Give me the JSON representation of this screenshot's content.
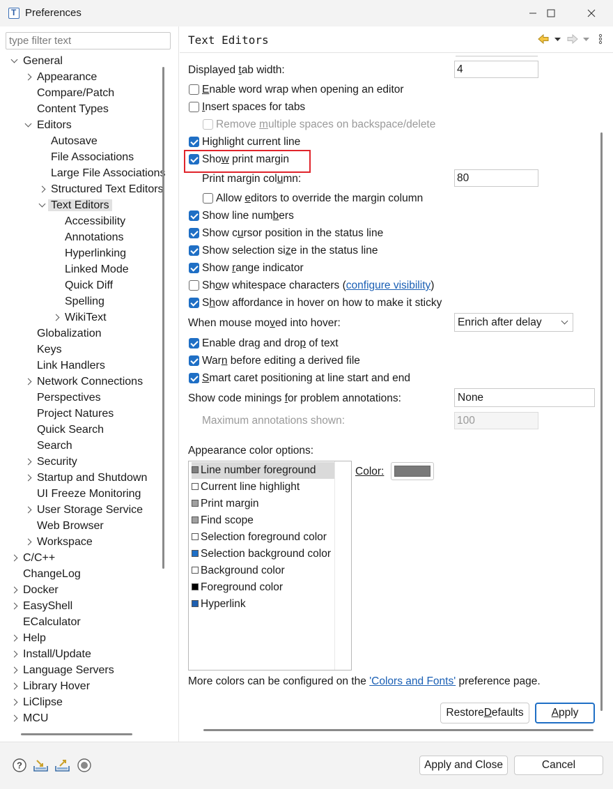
{
  "window": {
    "title": "Preferences"
  },
  "filter": {
    "placeholder": "type filter text"
  },
  "tree": [
    {
      "label": "General",
      "level": 0,
      "state": "expanded"
    },
    {
      "label": "Appearance",
      "level": 1,
      "state": "collapsed"
    },
    {
      "label": "Compare/Patch",
      "level": 1,
      "state": "leaf"
    },
    {
      "label": "Content Types",
      "level": 1,
      "state": "leaf"
    },
    {
      "label": "Editors",
      "level": 1,
      "state": "expanded"
    },
    {
      "label": "Autosave",
      "level": 2,
      "state": "leaf"
    },
    {
      "label": "File Associations",
      "level": 2,
      "state": "leaf"
    },
    {
      "label": "Large File Associations",
      "level": 2,
      "state": "leaf"
    },
    {
      "label": "Structured Text Editors",
      "level": 2,
      "state": "collapsed"
    },
    {
      "label": "Text Editors",
      "level": 2,
      "state": "expanded",
      "selected": true
    },
    {
      "label": "Accessibility",
      "level": 3,
      "state": "leaf"
    },
    {
      "label": "Annotations",
      "level": 3,
      "state": "leaf"
    },
    {
      "label": "Hyperlinking",
      "level": 3,
      "state": "leaf"
    },
    {
      "label": "Linked Mode",
      "level": 3,
      "state": "leaf"
    },
    {
      "label": "Quick Diff",
      "level": 3,
      "state": "leaf"
    },
    {
      "label": "Spelling",
      "level": 3,
      "state": "leaf"
    },
    {
      "label": "WikiText",
      "level": 3,
      "state": "collapsed"
    },
    {
      "label": "Globalization",
      "level": 1,
      "state": "leaf"
    },
    {
      "label": "Keys",
      "level": 1,
      "state": "leaf"
    },
    {
      "label": "Link Handlers",
      "level": 1,
      "state": "leaf"
    },
    {
      "label": "Network Connections",
      "level": 1,
      "state": "collapsed"
    },
    {
      "label": "Perspectives",
      "level": 1,
      "state": "leaf"
    },
    {
      "label": "Project Natures",
      "level": 1,
      "state": "leaf"
    },
    {
      "label": "Quick Search",
      "level": 1,
      "state": "leaf"
    },
    {
      "label": "Search",
      "level": 1,
      "state": "leaf"
    },
    {
      "label": "Security",
      "level": 1,
      "state": "collapsed"
    },
    {
      "label": "Startup and Shutdown",
      "level": 1,
      "state": "collapsed"
    },
    {
      "label": "UI Freeze Monitoring",
      "level": 1,
      "state": "leaf"
    },
    {
      "label": "User Storage Service",
      "level": 1,
      "state": "collapsed"
    },
    {
      "label": "Web Browser",
      "level": 1,
      "state": "leaf"
    },
    {
      "label": "Workspace",
      "level": 1,
      "state": "collapsed"
    },
    {
      "label": "C/C++",
      "level": 0,
      "state": "collapsed"
    },
    {
      "label": "ChangeLog",
      "level": 0,
      "state": "leaf"
    },
    {
      "label": "Docker",
      "level": 0,
      "state": "collapsed"
    },
    {
      "label": "EasyShell",
      "level": 0,
      "state": "collapsed"
    },
    {
      "label": "ECalculator",
      "level": 0,
      "state": "leaf"
    },
    {
      "label": "Help",
      "level": 0,
      "state": "collapsed"
    },
    {
      "label": "Install/Update",
      "level": 0,
      "state": "collapsed"
    },
    {
      "label": "Language Servers",
      "level": 0,
      "state": "collapsed"
    },
    {
      "label": "Library Hover",
      "level": 0,
      "state": "collapsed"
    },
    {
      "label": "LiClipse",
      "level": 0,
      "state": "collapsed"
    },
    {
      "label": "MCU",
      "level": 0,
      "state": "collapsed"
    }
  ],
  "page": {
    "title": "Text Editors",
    "tab_width": {
      "pre": "Displayed ",
      "u": "t",
      "post": "ab width:",
      "value": "4"
    },
    "word_wrap": {
      "pre": "",
      "u": "E",
      "post": "nable word wrap when opening an editor",
      "checked": false
    },
    "insert_spaces": {
      "pre": "",
      "u": "I",
      "post": "nsert spaces for tabs",
      "checked": false
    },
    "remove_spaces": {
      "pre": "Remove ",
      "u": "m",
      "post": "ultiple spaces on backspace/delete",
      "checked": false,
      "disabled": true
    },
    "highlight_line": {
      "pre": "Hi",
      "u": "g",
      "post": "hlight current line",
      "checked": true
    },
    "print_margin": {
      "pre": "Sho",
      "u": "w",
      "post": " print margin",
      "checked": true
    },
    "margin_column": {
      "pre": "Print margin col",
      "u": "u",
      "post": "mn:",
      "value": "80"
    },
    "allow_override": {
      "pre": "Allow ",
      "u": "e",
      "post": "ditors to override the margin column",
      "checked": false
    },
    "line_numbers": {
      "pre": "Show line num",
      "u": "b",
      "post": "ers",
      "checked": true
    },
    "cursor_position": {
      "pre": "Show c",
      "u": "u",
      "post": "rsor position in the status line",
      "checked": true
    },
    "selection_size": {
      "pre": "Show selection si",
      "u": "z",
      "post": "e in the status line",
      "checked": true
    },
    "range_indicator": {
      "pre": "Show ",
      "u": "r",
      "post": "ange indicator",
      "checked": true
    },
    "whitespace": {
      "pre": "Sh",
      "u": "o",
      "post": "w whitespace characters (",
      "link": "configure visibility",
      "tail": ")",
      "checked": false
    },
    "affordance": {
      "pre": "S",
      "u": "h",
      "post": "ow affordance in hover on how to make it sticky",
      "checked": true
    },
    "hover": {
      "pre": "When mouse mo",
      "u": "v",
      "post": "ed into hover:",
      "value": "Enrich after delay"
    },
    "drag_drop": {
      "pre": "Enable drag and dro",
      "u": "p",
      "post": " of text",
      "checked": true
    },
    "warn_derived": {
      "pre": "War",
      "u": "n",
      "post": " before editing a derived file",
      "checked": true
    },
    "smart_caret": {
      "pre": "",
      "u": "S",
      "post": "mart caret positioning at line start and end",
      "checked": true
    },
    "code_minings": {
      "pre": "Show code minings ",
      "u": "f",
      "post": "or problem annotations:",
      "value": "None"
    },
    "max_annotations": {
      "label": "Maximum annotations shown:",
      "value": "100"
    },
    "color_options_label": "Appearance color options:",
    "color_items": [
      {
        "label": "Line number foreground",
        "color": "#808080",
        "selected": true
      },
      {
        "label": "Current line highlight",
        "color": "#ffffff"
      },
      {
        "label": "Print margin",
        "color": "#a0a0a0"
      },
      {
        "label": "Find scope",
        "color": "#a0a0a0"
      },
      {
        "label": "Selection foreground color",
        "color": "#ffffff"
      },
      {
        "label": "Selection background color",
        "color": "#1e6fc6"
      },
      {
        "label": "Background color",
        "color": "#ffffff"
      },
      {
        "label": "Foreground color",
        "color": "#000000"
      },
      {
        "label": "Hyperlink",
        "color": "#1e5fb0"
      }
    ],
    "color_label": "Color:",
    "color_value": "#7a7a7a",
    "more_colors": {
      "pre": "More colors can be configured on the ",
      "link": "'Colors and Fonts'",
      "post": " preference page."
    },
    "restore_defaults": {
      "pre": "Restore ",
      "u": "D",
      "post": "efaults"
    },
    "apply": {
      "pre": "",
      "u": "A",
      "post": "pply"
    }
  },
  "footer": {
    "apply_and_close": "Apply and Close",
    "cancel": "Cancel"
  }
}
